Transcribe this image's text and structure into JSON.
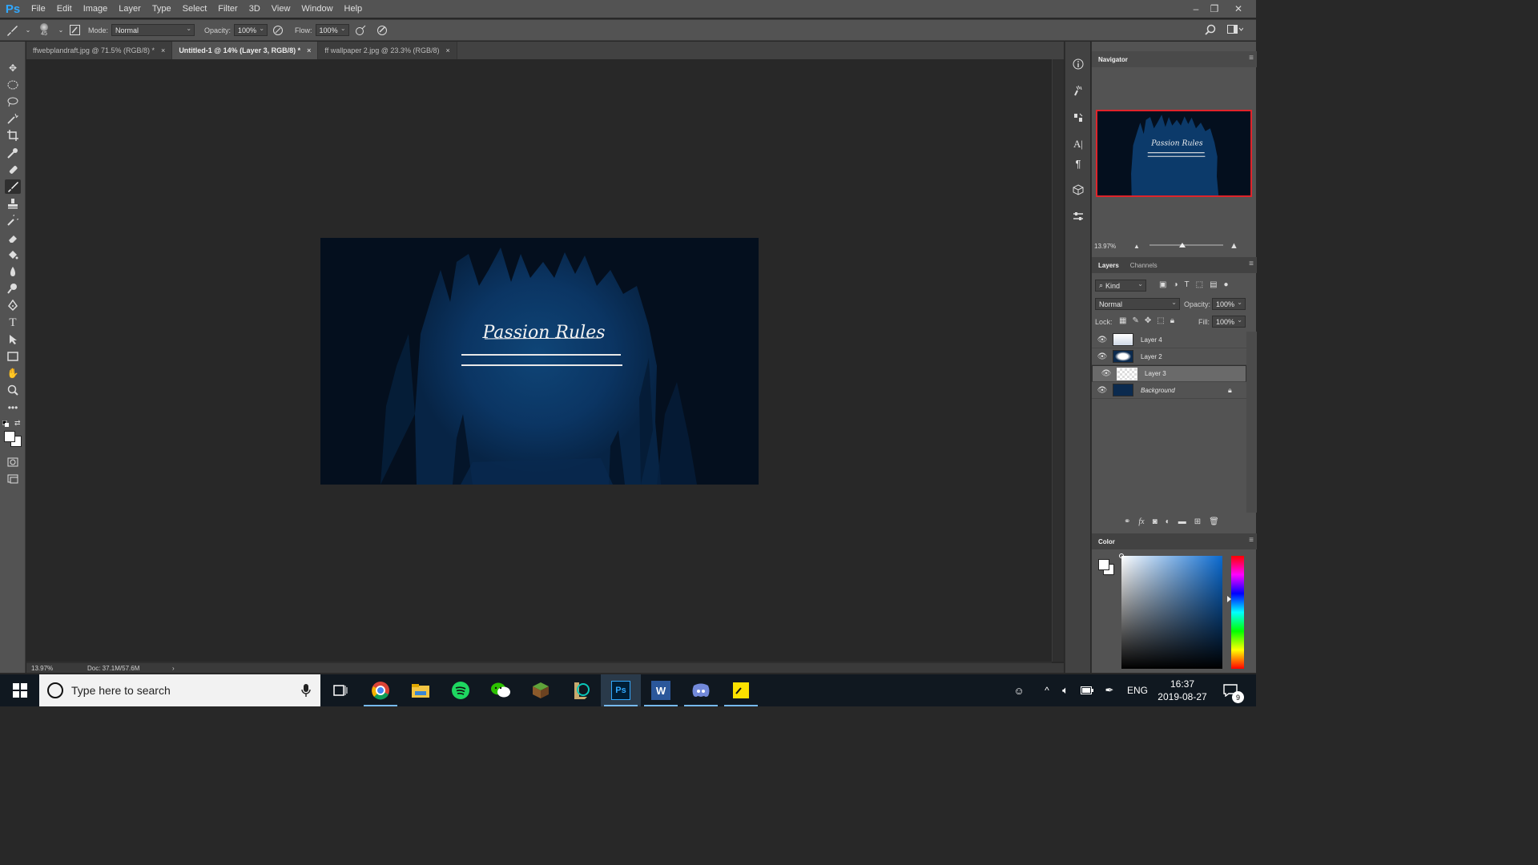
{
  "app": {
    "logo": "Ps"
  },
  "menu": [
    "File",
    "Edit",
    "Image",
    "Layer",
    "Type",
    "Select",
    "Filter",
    "3D",
    "View",
    "Window",
    "Help"
  ],
  "window_controls": {
    "minimize": "–",
    "restore": "❐",
    "close": "✕"
  },
  "options": {
    "brush_size": "45",
    "mode_label": "Mode:",
    "mode_value": "Normal",
    "opacity_label": "Opacity:",
    "opacity_value": "100%",
    "flow_label": "Flow:",
    "flow_value": "100%"
  },
  "tabs": [
    {
      "label": "ffwebplandraft.jpg @ 71.5% (RGB/8) *",
      "close": "×",
      "active": false
    },
    {
      "label": "Untitled-1 @ 14% (Layer 3, RGB/8) *",
      "close": "×",
      "active": true
    },
    {
      "label": "ff wallpaper 2.jpg @ 23.3% (RGB/8)",
      "close": "×",
      "active": false
    }
  ],
  "artwork": {
    "text": "Passion Rules"
  },
  "status": {
    "zoom": "13.97%",
    "doc": "Doc: 37.1M/57.6M",
    "arrow": "›"
  },
  "navigator": {
    "title": "Navigator",
    "zoom": "13.97%",
    "preview_text": "Passion Rules",
    "zoom_level": 0.45
  },
  "layers_panel": {
    "tabs": [
      "Layers",
      "Channels"
    ],
    "filter_label": "Kind",
    "blend_mode": "Normal",
    "opacity_label": "Opacity:",
    "opacity_value": "100%",
    "lock_label": "Lock:",
    "fill_label": "Fill:",
    "fill_value": "100%",
    "layers": [
      {
        "name": "Layer 4",
        "selected": false
      },
      {
        "name": "Layer 2",
        "selected": false
      },
      {
        "name": "Layer 3",
        "selected": true
      },
      {
        "name": "Background",
        "selected": false,
        "locked": true
      }
    ],
    "footer_icons": [
      "link-icon",
      "fx-icon",
      "mask-icon",
      "adjustment-icon",
      "folder-icon",
      "new-layer-icon",
      "trash-icon"
    ]
  },
  "color_panel": {
    "title": "Color"
  },
  "taskbar": {
    "search_placeholder": "Type here to search",
    "language": "ENG",
    "time": "16:37",
    "date": "2019-08-27",
    "notification_count": "9"
  },
  "colors": {
    "accent": "#31a8ff",
    "canvas_bg": "#0b2a4e",
    "panel": "#535353"
  }
}
